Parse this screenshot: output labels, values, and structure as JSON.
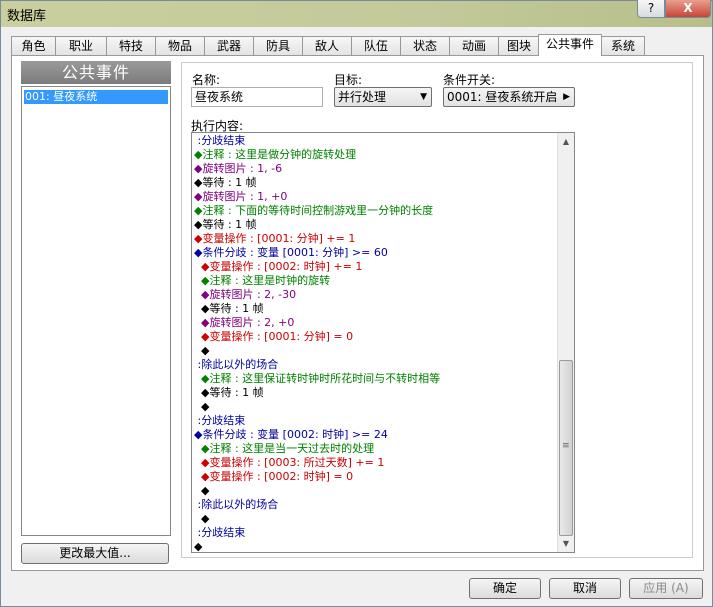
{
  "window": {
    "title": "数据库",
    "help_label": "?",
    "close_label": "X"
  },
  "tabs": [
    {
      "label": "角色"
    },
    {
      "label": "职业"
    },
    {
      "label": "特技"
    },
    {
      "label": "物品"
    },
    {
      "label": "武器"
    },
    {
      "label": "防具"
    },
    {
      "label": "敌人"
    },
    {
      "label": "队伍"
    },
    {
      "label": "状态"
    },
    {
      "label": "动画"
    },
    {
      "label": "图块"
    },
    {
      "label": "公共事件"
    },
    {
      "label": "系统"
    }
  ],
  "active_tab": "公共事件",
  "list": {
    "header": "公共事件",
    "items": [
      {
        "label": "001: 昼夜系统"
      }
    ],
    "max_button_label": "更改最大值..."
  },
  "form": {
    "name_label": "名称:",
    "name_value": "昼夜系统",
    "target_label": "目标:",
    "target_value": "并行处理",
    "switch_label": "条件开关:",
    "switch_value": "0001: 昼夜系统开启",
    "exec_label": "执行内容:"
  },
  "exec_lines": [
    {
      "text": " :分歧结束",
      "color": "blue"
    },
    {
      "text": "◆注释 : 这里是做分钟的旋转处理",
      "color": "green"
    },
    {
      "text": "◆旋转图片 : 1, -6",
      "color": "purple"
    },
    {
      "text": "◆等待 : 1 帧",
      "color": "black"
    },
    {
      "text": "◆旋转图片 : 1, +0",
      "color": "purple"
    },
    {
      "text": "◆注释 : 下面的等待时间控制游戏里一分钟的长度",
      "color": "green"
    },
    {
      "text": "◆等待 : 1 帧",
      "color": "black"
    },
    {
      "text": "◆变量操作 : [0001: 分钟] += 1",
      "color": "red"
    },
    {
      "text": "◆条件分歧 : 变量 [0001: 分钟] >= 60",
      "color": "blue"
    },
    {
      "text": "  ◆变量操作 : [0002: 时钟] += 1",
      "color": "red"
    },
    {
      "text": "  ◆注释 : 这里是时钟的旋转",
      "color": "green"
    },
    {
      "text": "  ◆旋转图片 : 2, -30",
      "color": "purple"
    },
    {
      "text": "  ◆等待 : 1 帧",
      "color": "black"
    },
    {
      "text": "  ◆旋转图片 : 2, +0",
      "color": "purple"
    },
    {
      "text": "  ◆变量操作 : [0001: 分钟] = 0",
      "color": "red"
    },
    {
      "text": "  ◆",
      "color": "black"
    },
    {
      "text": " :除此以外的场合",
      "color": "blue"
    },
    {
      "text": "  ◆注释 : 这里保证转时钟时所花时间与不转时相等",
      "color": "green"
    },
    {
      "text": "  ◆等待 : 1 帧",
      "color": "black"
    },
    {
      "text": "  ◆",
      "color": "black"
    },
    {
      "text": " :分歧结束",
      "color": "blue"
    },
    {
      "text": "◆条件分歧 : 变量 [0002: 时钟] >= 24",
      "color": "blue"
    },
    {
      "text": "  ◆注释 : 这里是当一天过去时的处理",
      "color": "green"
    },
    {
      "text": "  ◆变量操作 : [0003: 所过天数] += 1",
      "color": "red"
    },
    {
      "text": "  ◆变量操作 : [0002: 时钟] = 0",
      "color": "red"
    },
    {
      "text": "  ◆",
      "color": "black"
    },
    {
      "text": " :除此以外的场合",
      "color": "blue"
    },
    {
      "text": "  ◆",
      "color": "black"
    },
    {
      "text": " :分歧结束",
      "color": "blue"
    },
    {
      "text": "◆",
      "color": "black"
    }
  ],
  "buttons": {
    "ok": "确定",
    "cancel": "取消",
    "apply": "应用 (A)"
  }
}
